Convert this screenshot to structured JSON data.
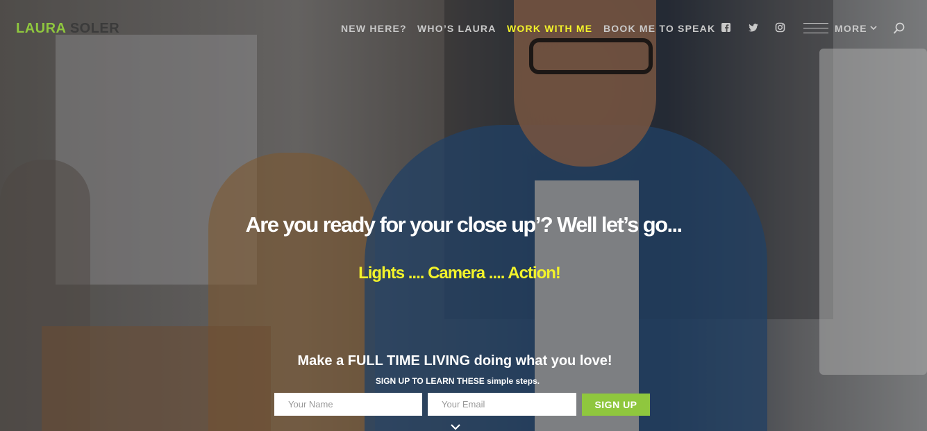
{
  "logo": {
    "first": "LAURA",
    "last": "SOLER"
  },
  "nav": {
    "items": [
      {
        "label": "NEW HERE?",
        "active": false
      },
      {
        "label": "WHO’S LAURA",
        "active": false
      },
      {
        "label": "WORK WITH ME",
        "active": true
      },
      {
        "label": "BOOK ME TO SPEAK",
        "active": false
      }
    ],
    "social": [
      "facebook-icon",
      "twitter-icon",
      "instagram-icon"
    ],
    "more_label": "MORE"
  },
  "hero": {
    "headline": "Are you ready for your close up’? Well let’s go...",
    "subheadline": "Lights .... Camera .... Action!"
  },
  "cta": {
    "title": "Make a FULL TIME LIVING doing what you love!",
    "subtitle": "SIGN UP TO LEARN THESE simple steps.",
    "name_placeholder": "Your Name",
    "email_placeholder": "Your Email",
    "button_label": "SIGN UP"
  },
  "colors": {
    "accent_green": "#8fc73e",
    "highlight_yellow": "#f3f32a"
  }
}
